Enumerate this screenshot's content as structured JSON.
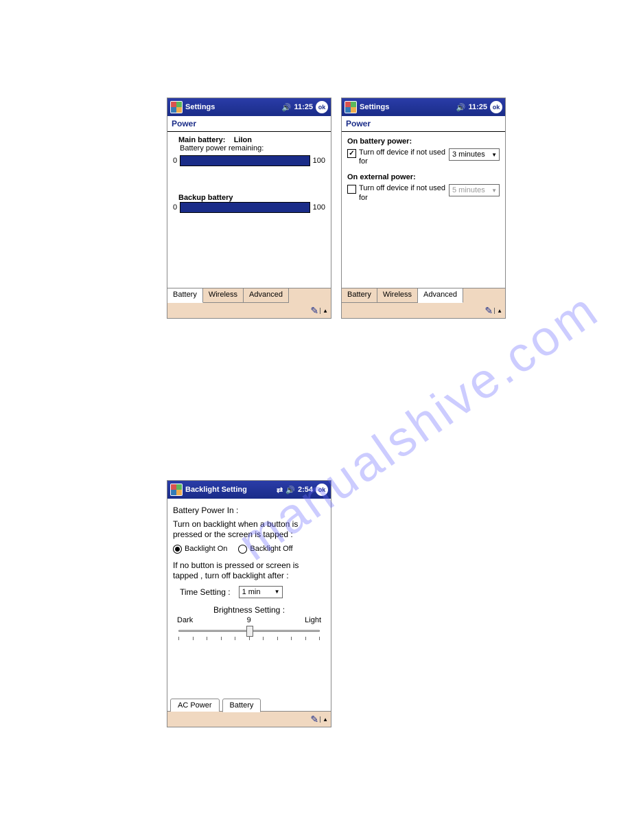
{
  "watermark": "manualshive.com",
  "screens": {
    "s1": {
      "titlebar": {
        "title": "Settings",
        "time": "11:25",
        "ok": "ok"
      },
      "subtitle": "Power",
      "main_battery_label": "Main battery:",
      "main_battery_type": "LiIon",
      "remaining_label": "Battery power remaining:",
      "backup_label": "Backup battery",
      "scale_min": "0",
      "scale_max": "100",
      "tabs": {
        "battery": "Battery",
        "wireless": "Wireless",
        "advanced": "Advanced"
      }
    },
    "s2": {
      "titlebar": {
        "title": "Settings",
        "time": "11:25",
        "ok": "ok"
      },
      "subtitle": "Power",
      "on_battery_label": "On battery power:",
      "on_battery_check": "Turn off device if not used for",
      "on_battery_value": "3 minutes",
      "on_external_label": "On external power:",
      "on_external_check": "Turn off device if not used for",
      "on_external_value": "5 minutes",
      "tabs": {
        "battery": "Battery",
        "wireless": "Wireless",
        "advanced": "Advanced"
      }
    },
    "s3": {
      "titlebar": {
        "title": "Backlight Setting",
        "time": "2:54",
        "ok": "ok"
      },
      "heading": "Battery Power In :",
      "instruction1": "Turn on backlight when a button is pressed or the screen is tapped :",
      "radio_on": "Backlight On",
      "radio_off": "Backlight Off",
      "instruction2": "If no button is pressed or screen is tapped , turn off backlight after :",
      "time_label": "Time Setting :",
      "time_value": "1 min",
      "brightness_label": "Brightness Setting :",
      "dark": "Dark",
      "bright_val": "9",
      "light": "Light",
      "tabs": {
        "ac": "AC Power",
        "battery": "Battery"
      }
    }
  },
  "chart_data": [
    {
      "type": "bar",
      "orientation": "horizontal",
      "title": "Main battery: LiIon — Battery power remaining",
      "categories": [
        "Main battery"
      ],
      "values": [
        100
      ],
      "xlim": [
        0,
        100
      ]
    },
    {
      "type": "bar",
      "orientation": "horizontal",
      "title": "Backup battery",
      "categories": [
        "Backup battery"
      ],
      "values": [
        100
      ],
      "xlim": [
        0,
        100
      ]
    }
  ]
}
